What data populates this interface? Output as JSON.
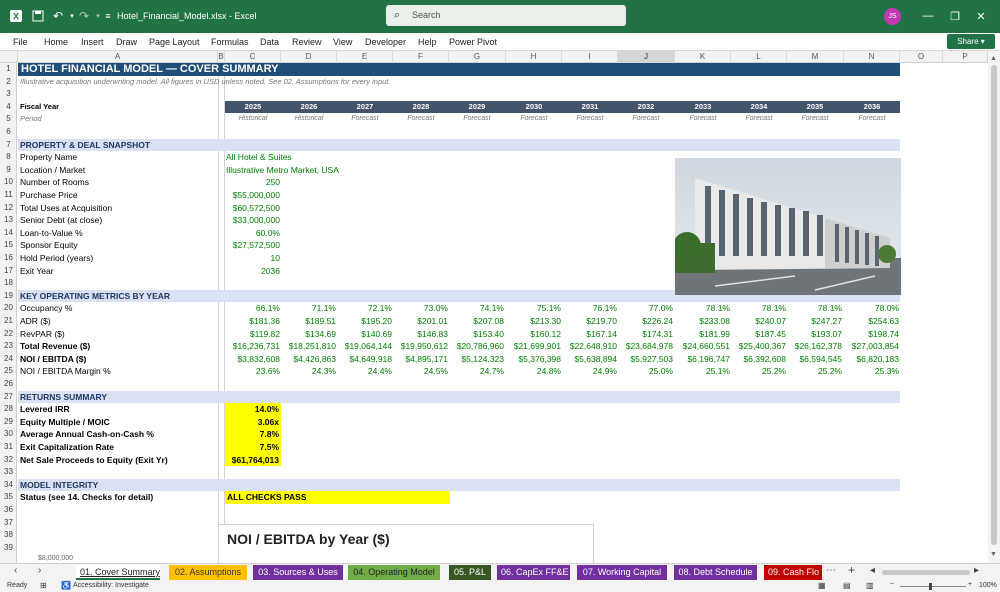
{
  "window": {
    "title": "Hotel_Financial_Model.xlsx  -  Excel",
    "search_placeholder": "Search",
    "avatar_initials": "JS",
    "share_label": "Share"
  },
  "menu": [
    "File",
    "Home",
    "Insert",
    "Draw",
    "Page Layout",
    "Formulas",
    "Data",
    "Review",
    "View",
    "Developer",
    "Help",
    "Power Pivot"
  ],
  "columns": [
    "A",
    "B",
    "C",
    "D",
    "E",
    "F",
    "G",
    "H",
    "I",
    "J",
    "K",
    "L",
    "M",
    "N",
    "O",
    "P"
  ],
  "rows": [
    "1",
    "2",
    "3",
    "4",
    "5",
    "6",
    "7",
    "8",
    "9",
    "10",
    "11",
    "12",
    "13",
    "14",
    "15",
    "16",
    "17",
    "18",
    "19",
    "20",
    "21",
    "22",
    "23",
    "24",
    "25",
    "26",
    "27",
    "28",
    "29",
    "30",
    "31",
    "32",
    "33",
    "34",
    "35",
    "36",
    "37",
    "38",
    "39"
  ],
  "sheet": {
    "title": "HOTEL FINANCIAL MODEL — COVER SUMMARY",
    "subtitle": "Illustrative acquisition underwriting model. All figures in USD unless noted. See 02. Assumptions for every input.",
    "fiscal_year_label": "Fiscal Year",
    "period_label": "Period",
    "years": [
      "2025",
      "2026",
      "2027",
      "2028",
      "2029",
      "2030",
      "2031",
      "2032",
      "2033",
      "2034",
      "2035",
      "2036"
    ],
    "periods": [
      "Historical",
      "Historical",
      "Forecast",
      "Forecast",
      "Forecast",
      "Forecast",
      "Forecast",
      "Forecast",
      "Forecast",
      "Forecast",
      "Forecast",
      "Forecast"
    ],
    "section_property": "PROPERTY & DEAL SNAPSHOT",
    "property": [
      {
        "label": "Property Name",
        "value": "All Hotel & Suites"
      },
      {
        "label": "Location / Market",
        "value": "Illustrative Metro Market, USA"
      },
      {
        "label": "Number of Rooms",
        "value": "250"
      },
      {
        "label": "Purchase Price",
        "value": "$55,000,000"
      },
      {
        "label": "Total Uses at Acquisition",
        "value": "$60,572,500"
      },
      {
        "label": "Senior Debt (at close)",
        "value": "$33,000,000"
      },
      {
        "label": "Loan-to-Value %",
        "value": "60.0%"
      },
      {
        "label": "Sponsor Equity",
        "value": "$27,572,500"
      },
      {
        "label": "Hold Period (years)",
        "value": "10"
      },
      {
        "label": "Exit Year",
        "value": "2036"
      }
    ],
    "section_metrics": "KEY OPERATING METRICS BY YEAR",
    "metrics": [
      {
        "label": "Occupancy %",
        "bold": false,
        "values": [
          "66.1%",
          "71.1%",
          "72.1%",
          "73.0%",
          "74.1%",
          "75.1%",
          "76.1%",
          "77.0%",
          "78.1%",
          "78.1%",
          "78.1%",
          "78.0%"
        ]
      },
      {
        "label": "ADR ($)",
        "bold": false,
        "values": [
          "$181.36",
          "$189.51",
          "$195.20",
          "$201.01",
          "$207.08",
          "$213.30",
          "$219.70",
          "$226.24",
          "$233.08",
          "$240.07",
          "$247.27",
          "$254.63"
        ]
      },
      {
        "label": "RevPAR ($)",
        "bold": false,
        "values": [
          "$119.82",
          "$134.69",
          "$140.69",
          "$146.83",
          "$153.40",
          "$160.12",
          "$167.14",
          "$174.31",
          "$181.99",
          "$187.45",
          "$193.07",
          "$198.74"
        ]
      },
      {
        "label": "Total Revenue ($)",
        "bold": true,
        "values": [
          "$16,236,731",
          "$18,251,810",
          "$19,064,144",
          "$19,950,612",
          "$20,786,960",
          "$21,699,901",
          "$22,648,910",
          "$23,684,978",
          "$24,660,551",
          "$25,400,367",
          "$26,162,378",
          "$27,003,854"
        ]
      },
      {
        "label": "NOI / EBITDA ($)",
        "bold": true,
        "values": [
          "$3,832,608",
          "$4,426,863",
          "$4,649,918",
          "$4,895,171",
          "$5,124,323",
          "$5,376,398",
          "$5,638,894",
          "$5,927,503",
          "$6,196,747",
          "$6,392,608",
          "$6,594,545",
          "$6,820,183"
        ]
      },
      {
        "label": "NOI / EBITDA Margin %",
        "bold": false,
        "values": [
          "23.6%",
          "24.3%",
          "24.4%",
          "24.5%",
          "24.7%",
          "24.8%",
          "24.9%",
          "25.0%",
          "25.1%",
          "25.2%",
          "25.2%",
          "25.3%"
        ]
      }
    ],
    "section_returns": "RETURNS SUMMARY",
    "returns": [
      {
        "label": "Levered IRR",
        "value": "14.0%"
      },
      {
        "label": "Equity Multiple / MOIC",
        "value": "3.06x"
      },
      {
        "label": "Average Annual Cash-on-Cash %",
        "value": "7.8%"
      },
      {
        "label": "Exit Capitalization Rate",
        "value": "7.5%"
      },
      {
        "label": "Net Sale Proceeds to Equity (Exit Yr)",
        "value": "$61,764,013"
      }
    ],
    "section_integrity": "MODEL INTEGRITY",
    "status_label": "Status (see 14. Checks for detail)",
    "status_value": "ALL CHECKS PASS",
    "chart_title": "NOI / EBITDA by Year ($)",
    "chart_tick": "$8,000,000"
  },
  "tabs": [
    {
      "label": "01. Cover Summary",
      "color": "#ffffff",
      "text": "#222222",
      "active": true
    },
    {
      "label": "02. Assumptions",
      "color": "#ffc000",
      "text": "#333333",
      "active": false
    },
    {
      "label": "03. Sources & Uses",
      "color": "#7030a0",
      "text": "#ffffff",
      "active": false
    },
    {
      "label": "04. Operating Model",
      "color": "#70ad47",
      "text": "#222222",
      "active": false
    },
    {
      "label": "05. P&L",
      "color": "#375623",
      "text": "#ffffff",
      "active": false
    },
    {
      "label": "06. CapEx FF&E",
      "color": "#7030a0",
      "text": "#ffffff",
      "active": false
    },
    {
      "label": "07. Working Capital",
      "color": "#7030a0",
      "text": "#ffffff",
      "active": false
    },
    {
      "label": "08. Debt Schedule",
      "color": "#7030a0",
      "text": "#ffffff",
      "active": false
    },
    {
      "label": "09. Cash Flo",
      "color": "#c00000",
      "text": "#ffffff",
      "active": false
    }
  ],
  "status": {
    "ready": "Ready",
    "accessibility": "Accessibility: Investigate",
    "zoom": "100%"
  }
}
